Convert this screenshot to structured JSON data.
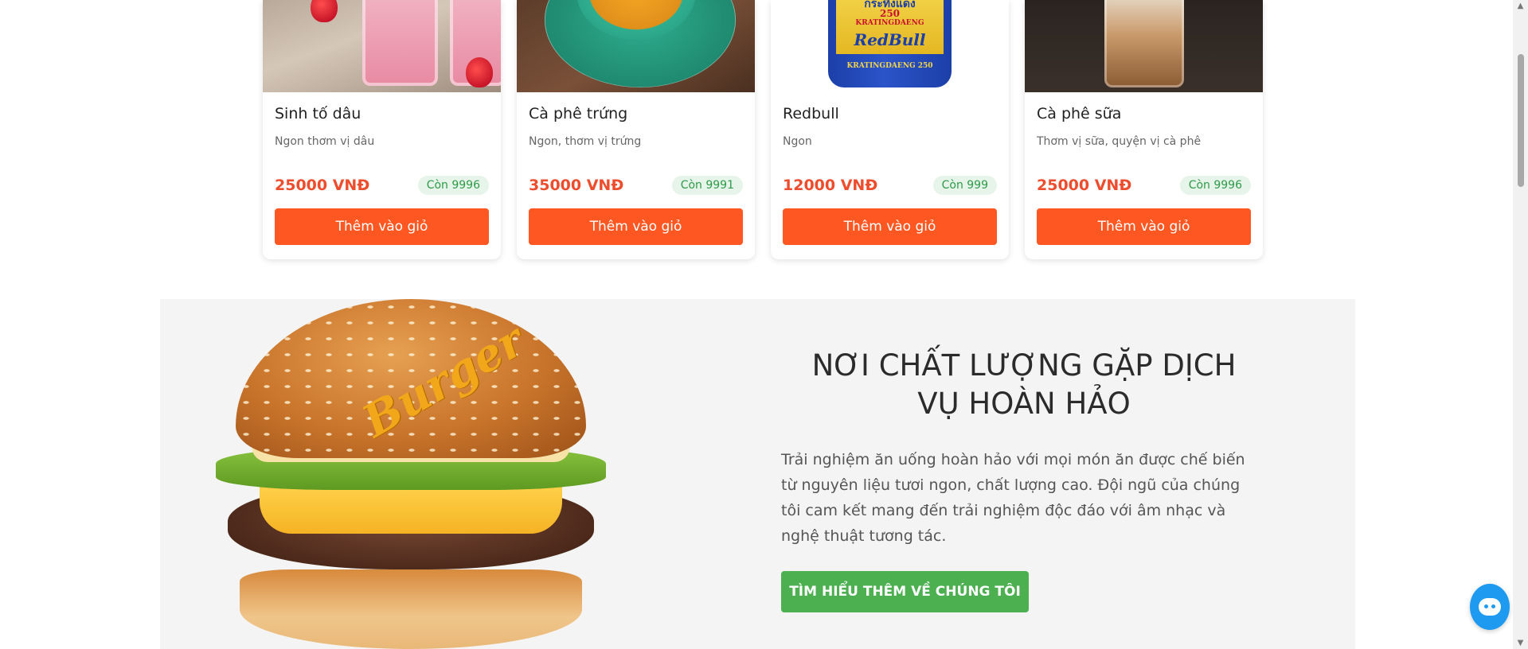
{
  "products": [
    {
      "name": "Sinh tố dâu",
      "description": "Ngon thơm vị dâu",
      "price": "25000 VNĐ",
      "stock": "Còn 9996",
      "button": "Thêm vào giỏ",
      "image": "strawberry-smoothie-image"
    },
    {
      "name": "Cà phê trứng",
      "description": "Ngon, thơm vị trứng",
      "price": "35000 VNĐ",
      "stock": "Còn 9991",
      "button": "Thêm vào giỏ",
      "image": "egg-coffee-image"
    },
    {
      "name": "Redbull",
      "description": "Ngon",
      "price": "12000 VNĐ",
      "stock": "Còn 999",
      "button": "Thêm vào giỏ",
      "image": "redbull-can-image",
      "can_text_top": "กระทิงแดง",
      "can_text_num": "250",
      "can_brand": "KRATINGDAENG",
      "can_logo": "RedBull",
      "can_bottom": "KRATINGDAENG 250"
    },
    {
      "name": "Cà phê sữa",
      "description": "Thơm vị sữa, quyện vị cà phê",
      "price": "25000 VNĐ",
      "stock": "Còn 9996",
      "button": "Thêm vào giỏ",
      "image": "iced-milk-coffee-image"
    }
  ],
  "about": {
    "title": "NƠI CHẤT LƯỢNG GẶP DỊCH VỤ HOÀN HẢO",
    "description": "Trải nghiệm ăn uống hoàn hảo với mọi món ăn được chế biến từ nguyên liệu tươi ngon, chất lượng cao. Đội ngũ của chúng tôi cam kết mang đến trải nghiệm độc đáo với âm nhạc và nghệ thuật tương tác.",
    "button": "TÌM HIỂU THÊM VỀ CHÚNG TÔI",
    "image": "burger-image",
    "image_script": "Burger"
  },
  "colors": {
    "price": "#ee4d2d",
    "add_button": "#ff5722",
    "stock_badge_bg": "#e6f4ea",
    "stock_badge_text": "#2e9b48",
    "about_button": "#4caf50",
    "about_bg": "#f4f4f4",
    "chat_bubble": "#1e9bf0"
  },
  "chat": {
    "icon": "chat-bot-icon"
  }
}
